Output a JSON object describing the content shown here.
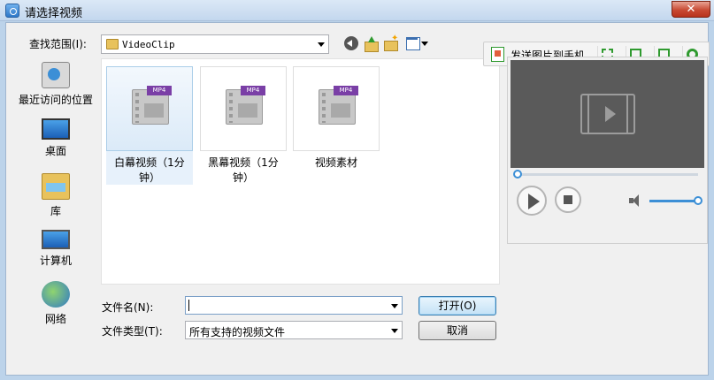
{
  "window": {
    "title": "请选择视频",
    "close_glyph": "✕"
  },
  "toolbar": {
    "send_label": "发送图片到手机"
  },
  "look_in": {
    "label": "查找范围(I):",
    "value": "VideoClip"
  },
  "files": [
    {
      "name": "白幕视频（1分钟）",
      "tag": "MP4",
      "selected": true
    },
    {
      "name": "黑幕视频（1分钟）",
      "tag": "MP4",
      "selected": false
    },
    {
      "name": "视频素材",
      "tag": "MP4",
      "selected": false
    }
  ],
  "places": [
    {
      "label": "最近访问的位置",
      "icon": "recent-places-icon"
    },
    {
      "label": "桌面",
      "icon": "desktop-icon"
    },
    {
      "label": "库",
      "icon": "libraries-icon"
    },
    {
      "label": "计算机",
      "icon": "computer-icon"
    },
    {
      "label": "网络",
      "icon": "network-icon"
    }
  ],
  "filename": {
    "label": "文件名(N):",
    "value": ""
  },
  "filetype": {
    "label": "文件类型(T):",
    "value": "所有支持的视频文件"
  },
  "buttons": {
    "open": "打开(O)",
    "cancel": "取消"
  },
  "player": {
    "progress": 0.0,
    "volume": 1.0
  },
  "colors": {
    "accent": "#3c8fd6",
    "toolbar_icon": "#2f9a2f",
    "titlebar": "#c3d7ee"
  }
}
